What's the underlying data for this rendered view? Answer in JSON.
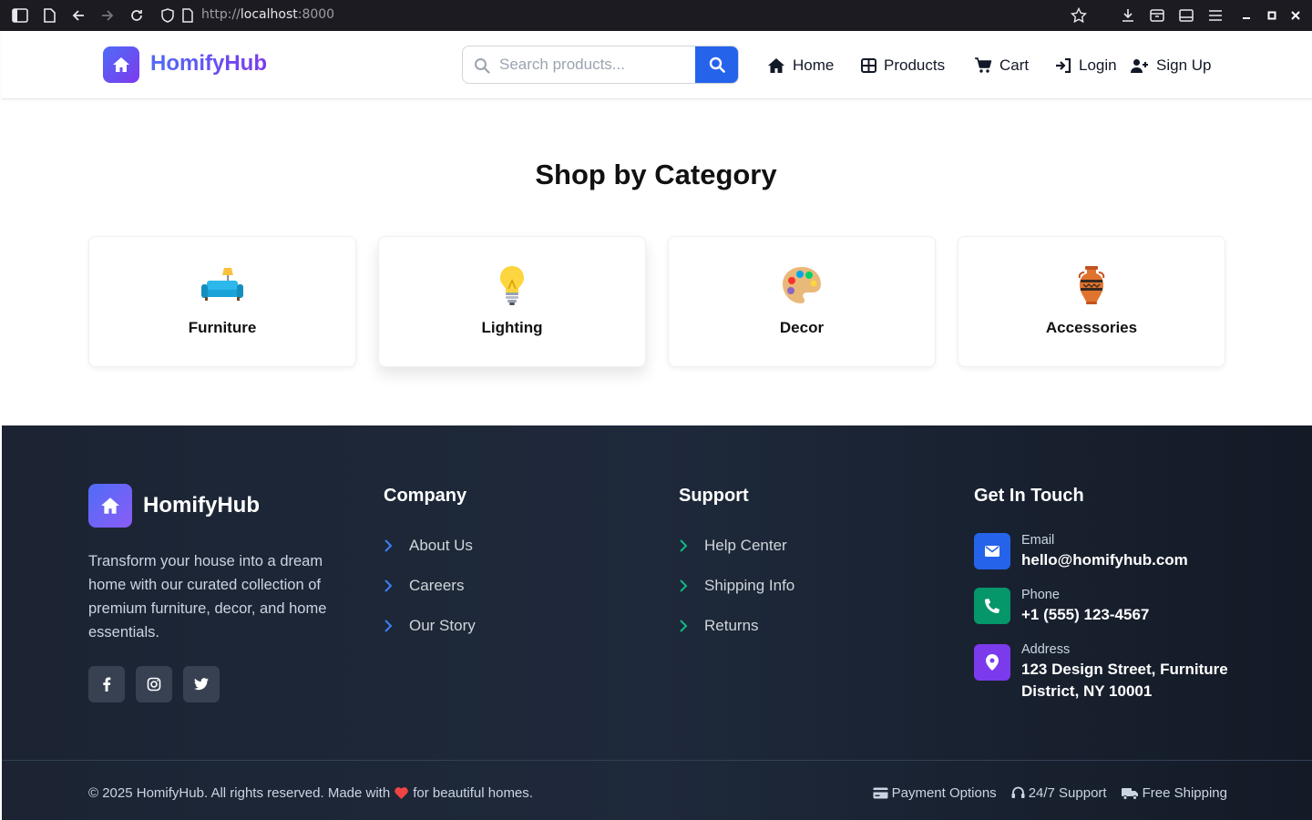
{
  "browser": {
    "url_prefix": "http://",
    "url_host": "localhost",
    "url_port": ":8000"
  },
  "header": {
    "brand": "HomifyHub",
    "search_placeholder": "Search products...",
    "nav": [
      {
        "label": "Home",
        "icon": "home-icon"
      },
      {
        "label": "Products",
        "icon": "grid-icon"
      },
      {
        "label": "Cart",
        "icon": "cart-icon"
      },
      {
        "label": "Login",
        "icon": "sign-in-icon"
      },
      {
        "label": "Sign Up",
        "icon": "user-plus-icon"
      }
    ]
  },
  "categories": {
    "title": "Shop by Category",
    "items": [
      {
        "label": "Furniture",
        "icon": "couch-and-lamp-icon"
      },
      {
        "label": "Lighting",
        "icon": "light-bulb-icon"
      },
      {
        "label": "Decor",
        "icon": "artist-palette-icon"
      },
      {
        "label": "Accessories",
        "icon": "amphora-icon"
      }
    ]
  },
  "footer": {
    "brand": "HomifyHub",
    "description": "Transform your house into a dream home with our curated collection of premium furniture, decor, and home essentials.",
    "social": [
      "facebook-icon",
      "instagram-icon",
      "twitter-icon"
    ],
    "company": {
      "heading": "Company",
      "links": [
        "About Us",
        "Careers",
        "Our Story"
      ]
    },
    "support": {
      "heading": "Support",
      "links": [
        "Help Center",
        "Shipping Info",
        "Returns"
      ]
    },
    "contact": {
      "heading": "Get In Touch",
      "email_label": "Email",
      "email": "hello@homifyhub.com",
      "phone_label": "Phone",
      "phone": "+1 (555) 123-4567",
      "address_label": "Address",
      "address": "123 Design Street, Furniture District, NY 10001"
    },
    "copyright_before": "© 2025 HomifyHub. All rights reserved. Made with",
    "copyright_after": "for beautiful homes.",
    "bottom_links": [
      "Payment Options",
      "24/7 Support",
      "Free Shipping"
    ]
  },
  "colors": {
    "primary_blue": "#2563eb",
    "brand_purple": "#7c3aed",
    "footer_bg": "#1e293b",
    "email_icon_bg": "#2563eb",
    "phone_icon_bg": "#059669",
    "address_icon_bg": "#7c3aed",
    "heart": "#ef4444"
  }
}
